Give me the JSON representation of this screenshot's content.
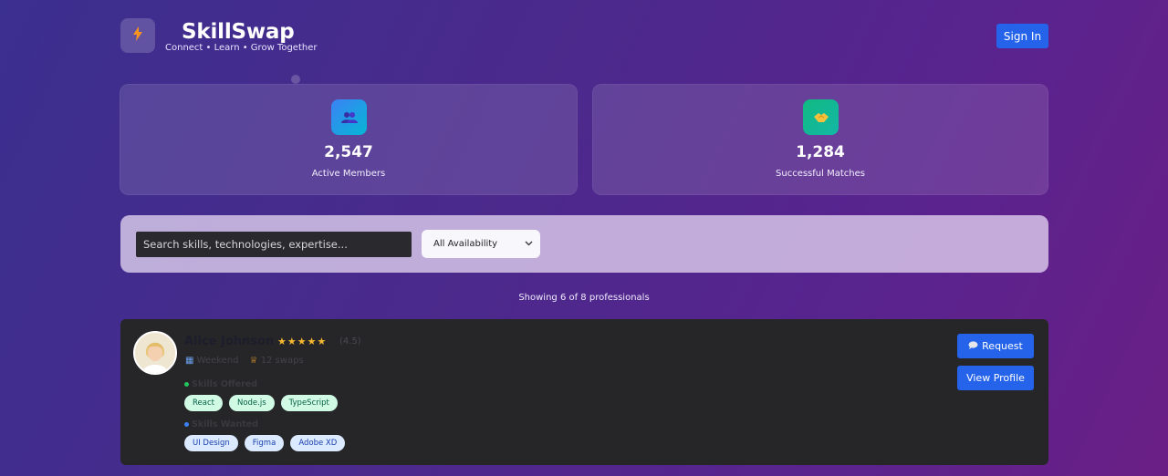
{
  "header": {
    "logo_icon": "lightning-icon",
    "title": "SkillSwap",
    "subtitle": "Connect • Learn • Grow Together",
    "signin_label": "Sign In"
  },
  "stats": [
    {
      "icon": "people-icon",
      "value": "2,547",
      "label": "Active Members"
    },
    {
      "icon": "handshake-icon",
      "value": "1,284",
      "label": "Successful Matches"
    }
  ],
  "search": {
    "placeholder": "Search skills, technologies, expertise...",
    "availability_selected": "All Availability"
  },
  "results_text": "Showing 6 of 8 professionals",
  "profiles": [
    {
      "name": "Alice Johnson",
      "stars": "★★★★★",
      "rating": "(4.5)",
      "availability": "Weekend",
      "swaps": "12 swaps",
      "offered_label": "Skills Offered",
      "offered": [
        "React",
        "Node.js",
        "TypeScript"
      ],
      "wanted_label": "Skills Wanted",
      "wanted": [
        "UI Design",
        "Figma",
        "Adobe XD"
      ],
      "request_label": "Request",
      "view_label": "View Profile"
    }
  ],
  "colors": {
    "accent": "#2563eb",
    "tag_offered_bg": "#d1fae5",
    "tag_wanted_bg": "#dbeafe",
    "star": "#f5b82e"
  }
}
